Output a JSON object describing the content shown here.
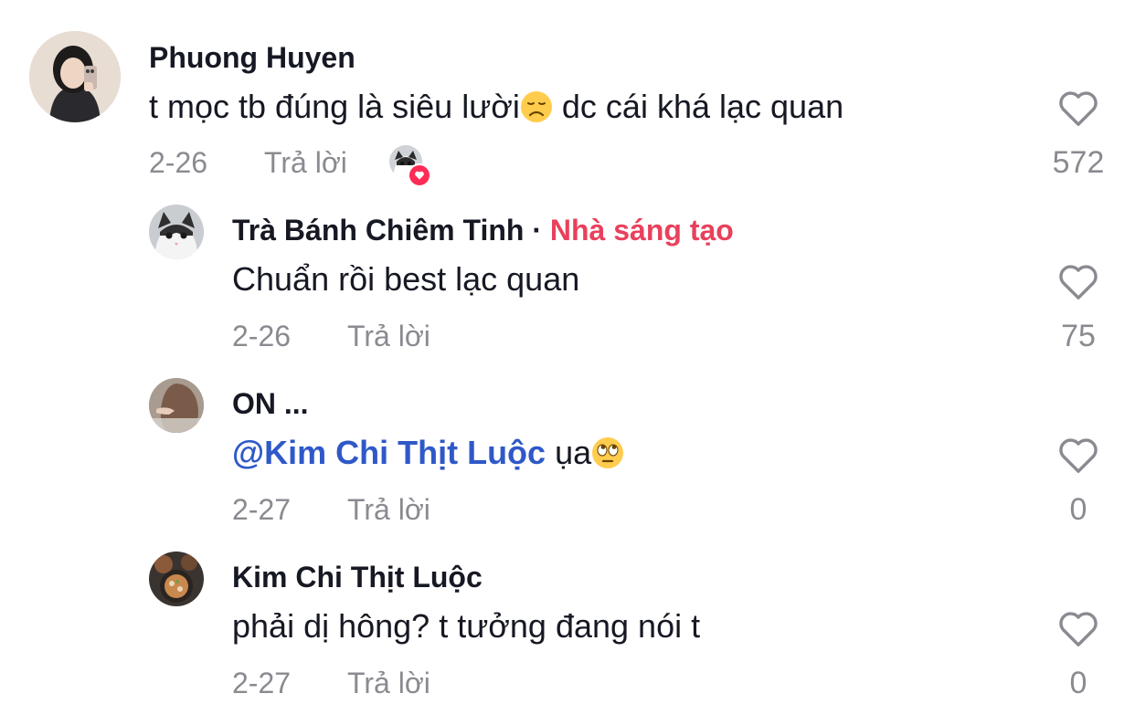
{
  "comments": [
    {
      "author": "Phuong Huyen",
      "text": "t mọc tb đúng là siêu lười",
      "text_after_emoji": " dc cái khá lạc quan",
      "emoji": "disappointed-face-emoji",
      "date": "2-26",
      "reply_label": "Trả lời",
      "likes": "572"
    },
    {
      "author": "Trà Bánh Chiêm Tinh",
      "separator": " · ",
      "badge": "Nhà sáng tạo",
      "text": "Chuẩn rồi best lạc quan",
      "date": "2-26",
      "reply_label": "Trả lời",
      "likes": "75"
    },
    {
      "author": "ON ...",
      "mention": "@Kim Chi Thịt Luộc",
      "text": " ụa",
      "emoji": "face-with-rolling-eyes-emoji",
      "date": "2-27",
      "reply_label": "Trả lời",
      "likes": "0"
    },
    {
      "author": "Kim Chi Thịt Luộc",
      "text": "phải dị hông? t tưởng đang nói t",
      "date": "2-27",
      "reply_label": "Trả lời",
      "likes": "0"
    }
  ],
  "colors": {
    "creator_badge": "#e8415c",
    "mention": "#2f58c8",
    "muted": "#8a8b91",
    "text": "#161823",
    "like_heart_badge": "#fe2c55"
  },
  "icons": {
    "like": "heart-outline-icon",
    "liked_by_creator": "heart-filled-icon"
  }
}
